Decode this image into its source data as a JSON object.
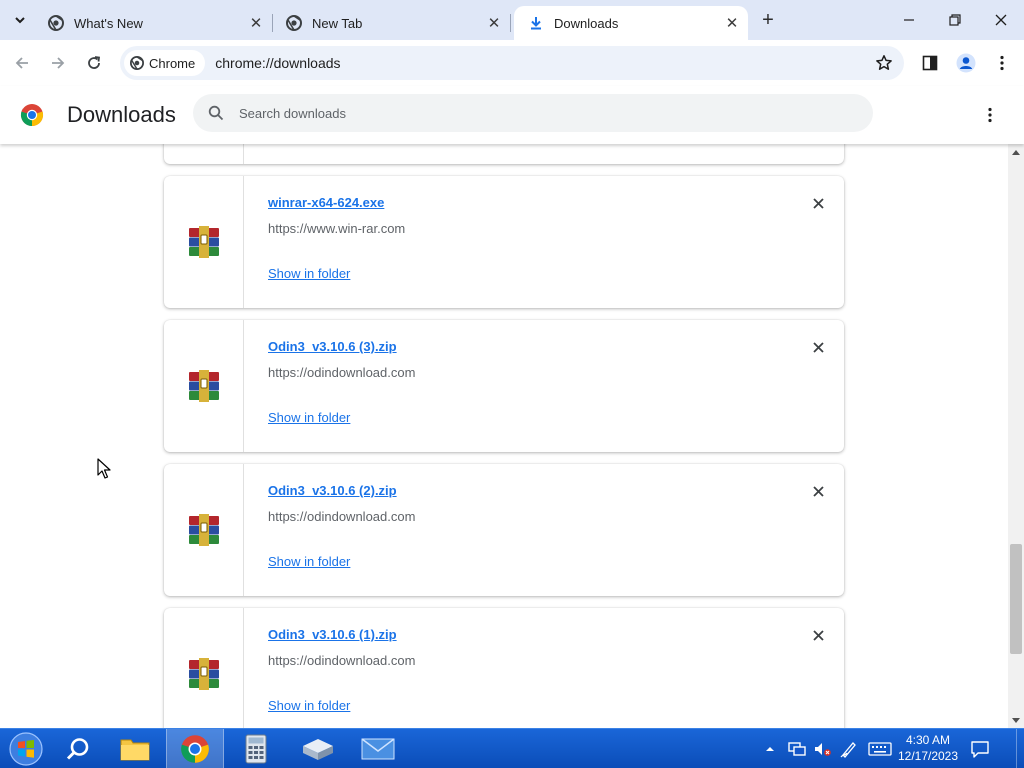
{
  "browser": {
    "tabs": [
      {
        "title": "What's New",
        "icon": "chrome-icon",
        "active": false
      },
      {
        "title": "New Tab",
        "icon": "chrome-icon",
        "active": false
      },
      {
        "title": "Downloads",
        "icon": "download-icon",
        "active": true
      }
    ],
    "omnibox": {
      "chip_label": "Chrome",
      "url": "chrome://downloads"
    }
  },
  "page": {
    "title": "Downloads",
    "search_placeholder": "Search downloads"
  },
  "downloads": [
    {
      "file_name": "winrar-x64-624.exe",
      "source_url": "https://www.win-rar.com",
      "action": "Show in folder",
      "icon": "winrar-archive-icon"
    },
    {
      "file_name": "Odin3_v3.10.6 (3).zip",
      "source_url": "https://odindownload.com",
      "action": "Show in folder",
      "icon": "winrar-archive-icon"
    },
    {
      "file_name": "Odin3_v3.10.6 (2).zip",
      "source_url": "https://odindownload.com",
      "action": "Show in folder",
      "icon": "winrar-archive-icon"
    },
    {
      "file_name": "Odin3_v3.10.6 (1).zip",
      "source_url": "https://odindownload.com",
      "action": "Show in folder",
      "icon": "winrar-archive-icon"
    }
  ],
  "taskbar": {
    "items": [
      "start-orb",
      "search",
      "file-explorer",
      "chrome",
      "calculator",
      "package",
      "mail"
    ],
    "clock": {
      "time": "4:30 AM",
      "date": "12/17/2023"
    }
  },
  "colors": {
    "link": "#1a73e8",
    "tabstrip": "#dfe7f7",
    "taskbar": "#1356c9"
  }
}
